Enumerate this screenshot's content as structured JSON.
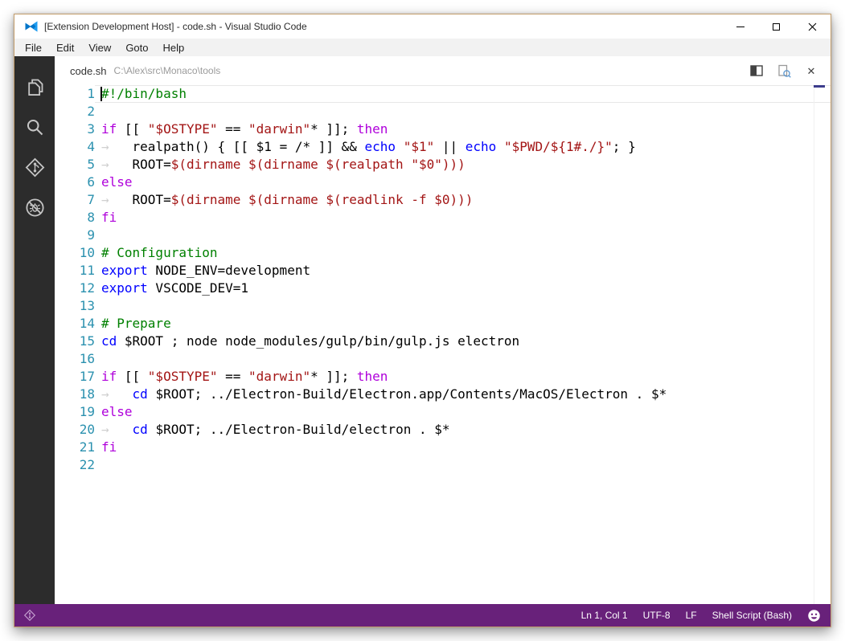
{
  "window": {
    "title": "[Extension Development Host] - code.sh - Visual Studio Code"
  },
  "menu": {
    "items": [
      "File",
      "Edit",
      "View",
      "Goto",
      "Help"
    ]
  },
  "activity_bar": {
    "items": [
      "explorer",
      "search",
      "git",
      "debug"
    ]
  },
  "editor": {
    "tab": {
      "file": "code.sh",
      "path": "C:\\Alex\\src\\Monaco\\tools"
    },
    "cursor": {
      "line": 1,
      "column": 1
    },
    "colors": {
      "tx": "#000000",
      "cm": "#008000",
      "kw": "#af00db",
      "fn": "#0000ff",
      "st": "#a31515",
      "ws": "#d0d0d0"
    },
    "lines": [
      [
        [
          "cm",
          "#!/bin/bash"
        ]
      ],
      [],
      [
        [
          "kw",
          "if"
        ],
        [
          "tx",
          " [[ "
        ],
        [
          "st",
          "\"$OSTYPE\""
        ],
        [
          "tx",
          " == "
        ],
        [
          "st",
          "\"darwin\""
        ],
        [
          "tx",
          "* ]]; "
        ],
        [
          "kw",
          "then"
        ]
      ],
      [
        [
          "ws",
          "→"
        ],
        [
          "tx",
          "   realpath() { [[ $1 = /* ]] && "
        ],
        [
          "fn",
          "echo"
        ],
        [
          "tx",
          " "
        ],
        [
          "st",
          "\"$1\""
        ],
        [
          "tx",
          " || "
        ],
        [
          "fn",
          "echo"
        ],
        [
          "tx",
          " "
        ],
        [
          "st",
          "\"$PWD/${1#./}\""
        ],
        [
          "tx",
          "; }"
        ]
      ],
      [
        [
          "ws",
          "→"
        ],
        [
          "tx",
          "   ROOT="
        ],
        [
          "st",
          "$(dirname $(dirname $(realpath \"$0\")))"
        ]
      ],
      [
        [
          "kw",
          "else"
        ]
      ],
      [
        [
          "ws",
          "→"
        ],
        [
          "tx",
          "   ROOT="
        ],
        [
          "st",
          "$(dirname $(dirname $(readlink -f $0)))"
        ]
      ],
      [
        [
          "kw",
          "fi"
        ]
      ],
      [],
      [
        [
          "cm",
          "# Configuration"
        ]
      ],
      [
        [
          "fn",
          "export"
        ],
        [
          "tx",
          " NODE_ENV=development"
        ]
      ],
      [
        [
          "fn",
          "export"
        ],
        [
          "tx",
          " VSCODE_DEV=1"
        ]
      ],
      [],
      [
        [
          "cm",
          "# Prepare"
        ]
      ],
      [
        [
          "fn",
          "cd"
        ],
        [
          "tx",
          " $ROOT ; node node_modules/gulp/bin/gulp.js electron"
        ]
      ],
      [],
      [
        [
          "kw",
          "if"
        ],
        [
          "tx",
          " [[ "
        ],
        [
          "st",
          "\"$OSTYPE\""
        ],
        [
          "tx",
          " == "
        ],
        [
          "st",
          "\"darwin\""
        ],
        [
          "tx",
          "* ]]; "
        ],
        [
          "kw",
          "then"
        ]
      ],
      [
        [
          "ws",
          "→"
        ],
        [
          "tx",
          "   "
        ],
        [
          "fn",
          "cd"
        ],
        [
          "tx",
          " $ROOT; ../Electron-Build/Electron.app/Contents/MacOS/Electron . $*"
        ]
      ],
      [
        [
          "kw",
          "else"
        ]
      ],
      [
        [
          "ws",
          "→"
        ],
        [
          "tx",
          "   "
        ],
        [
          "fn",
          "cd"
        ],
        [
          "tx",
          " $ROOT; ../Electron-Build/electron . $*"
        ]
      ],
      [
        [
          "kw",
          "fi"
        ]
      ],
      []
    ]
  },
  "status_bar": {
    "right_items": [
      {
        "id": "cursor-position",
        "label": "Ln 1, Col 1"
      },
      {
        "id": "encoding",
        "label": "UTF-8"
      },
      {
        "id": "eol",
        "label": "LF"
      },
      {
        "id": "language-mode",
        "label": "Shell Script (Bash)"
      }
    ]
  }
}
